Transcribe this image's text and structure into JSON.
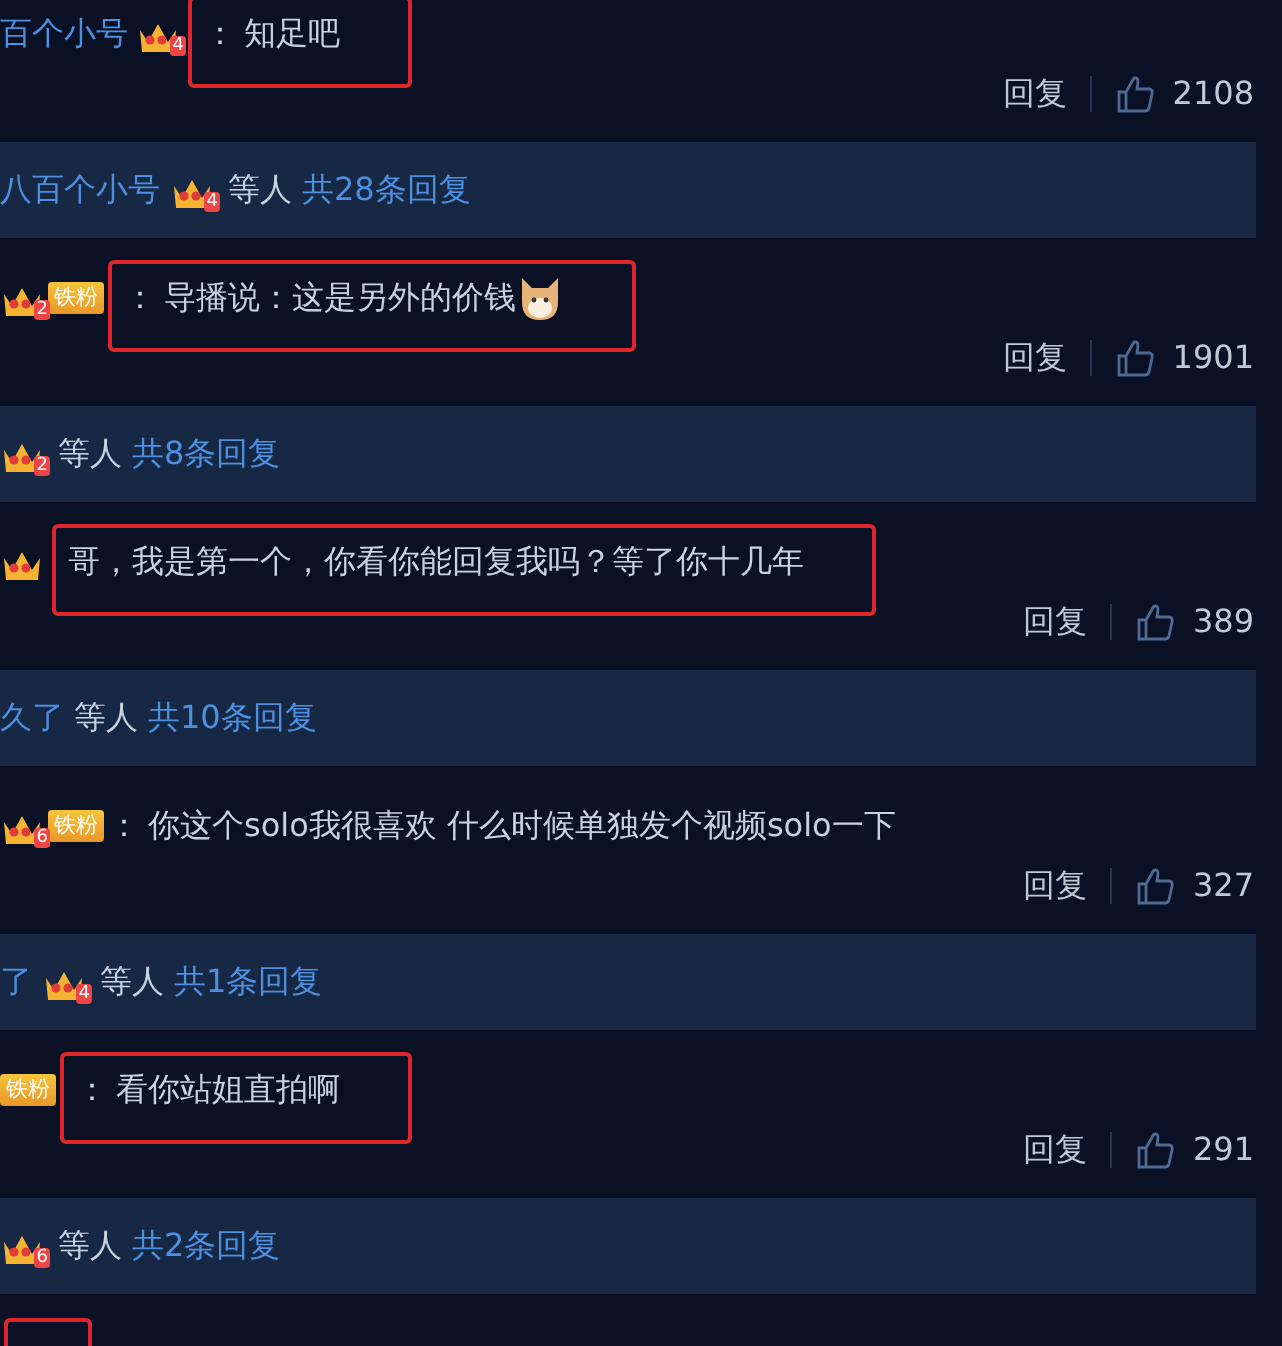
{
  "items": [
    {
      "kind": "comment",
      "author": "百个小号",
      "crown_level": "4",
      "colon": "：",
      "text": "知足吧",
      "highlighted": true,
      "reply_label": "回复",
      "likes": "2108"
    },
    {
      "kind": "summary",
      "names": "八百个小号",
      "crown_level": "4",
      "others": "等人",
      "total": "共28条回复"
    },
    {
      "kind": "comment",
      "crown_level": "2",
      "fan_badge": "铁粉",
      "colon": "：",
      "text": "导播说：这是另外的价钱",
      "sticker": true,
      "highlighted": true,
      "reply_label": "回复",
      "likes": "1901"
    },
    {
      "kind": "summary",
      "crown_level": "2",
      "others": "等人",
      "total": "共8条回复"
    },
    {
      "kind": "comment",
      "crown_cut": true,
      "text": "哥，我是第一个，你看你能回复我吗？等了你十几年",
      "highlighted": true,
      "reply_label": "回复",
      "likes": "389"
    },
    {
      "kind": "summary",
      "names": "久了",
      "others": "等人",
      "total": "共10条回复"
    },
    {
      "kind": "comment",
      "crown_level": "6",
      "fan_badge": "铁粉",
      "colon": "：",
      "text": "你这个solo我很喜欢 什么时候单独发个视频solo一下",
      "highlighted": false,
      "reply_label": "回复",
      "likes": "327"
    },
    {
      "kind": "summary",
      "names": "了",
      "crown_level": "4",
      "others": "等人",
      "total": "共1条回复"
    },
    {
      "kind": "comment",
      "fan_badge": "铁粉",
      "colon": "：",
      "text": "看你站姐直拍啊",
      "highlighted": true,
      "reply_label": "回复",
      "likes": "291"
    },
    {
      "kind": "summary",
      "crown_level": "6",
      "others": "等人",
      "total": "共2条回复"
    },
    {
      "kind": "comment",
      "highlighted": true
    }
  ]
}
